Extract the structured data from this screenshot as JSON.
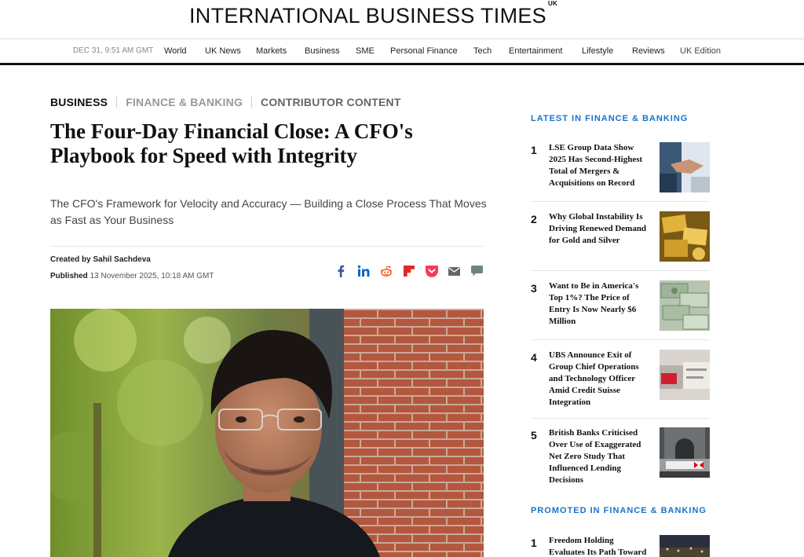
{
  "masthead": {
    "title": "INTERNATIONAL BUSINESS TIMES",
    "edition_sup": "UK"
  },
  "nav": {
    "date": "DEC 31, 9:51 AM GMT",
    "items": [
      "World",
      "UK News",
      "Markets",
      "Business",
      "SME",
      "Personal Finance",
      "Tech",
      "Entertainment",
      "Lifestyle",
      "Reviews"
    ],
    "edition": "UK Edition"
  },
  "article": {
    "categories": [
      "BUSINESS",
      "FINANCE & BANKING",
      "CONTRIBUTOR CONTENT"
    ],
    "headline": "The Four-Day Financial Close: A CFO's Playbook for Speed with Integrity",
    "standfirst": "The CFO's Framework for Velocity and Accuracy — Building a Close Process That Moves as Fast as Your Business",
    "created_by_label": "Created by",
    "author": "Sahil Sachdeva",
    "published_label": "Published",
    "published_date": "13 November 2025, 10:18 AM GMT"
  },
  "share_icons": [
    "facebook-icon",
    "linkedin-icon",
    "reddit-icon",
    "flipboard-icon",
    "pocket-icon",
    "email-icon",
    "comment-icon"
  ],
  "sidebar": {
    "latest_title": "LATEST IN FINANCE & BANKING",
    "latest": [
      {
        "num": "1",
        "title": "LSE Group Data Show 2025 Has Second-Highest Total of Mergers & Acquisitions on Record"
      },
      {
        "num": "2",
        "title": "Why Global Instability Is Driving Renewed Demand for Gold and Silver"
      },
      {
        "num": "3",
        "title": "Want to Be in America's Top 1%? The Price of Entry Is Now Nearly $6 Million"
      },
      {
        "num": "4",
        "title": "UBS Announce Exit of Group Chief Operations and Technology Officer Amid Credit Suisse Integration"
      },
      {
        "num": "5",
        "title": "British Banks Criticised Over Use of Exaggerated Net Zero Study That Influenced Lending Decisions"
      }
    ],
    "promoted_title": "PROMOTED IN FINANCE & BANKING",
    "promoted": [
      {
        "num": "1",
        "title": "Freedom Holding Evaluates Its Path Toward"
      }
    ]
  },
  "colors": {
    "accent_blue": "#1a73c9",
    "text": "#111111",
    "muted": "#999999"
  }
}
